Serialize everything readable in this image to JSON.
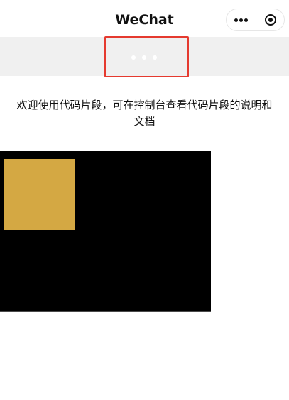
{
  "nav": {
    "title": "WeChat",
    "more_icon": "more-dots-icon",
    "close_icon": "target-circle-icon"
  },
  "loading": {
    "icon": "loading-dots-icon"
  },
  "intro": {
    "text": "欢迎使用代码片段，可在控制台查看代码片段的说明和文档"
  },
  "colors": {
    "highlight": "#e53a2f",
    "rect_fill": "#d4a843",
    "canvas_bg": "#000000",
    "loading_bg": "#f0f0f0"
  }
}
